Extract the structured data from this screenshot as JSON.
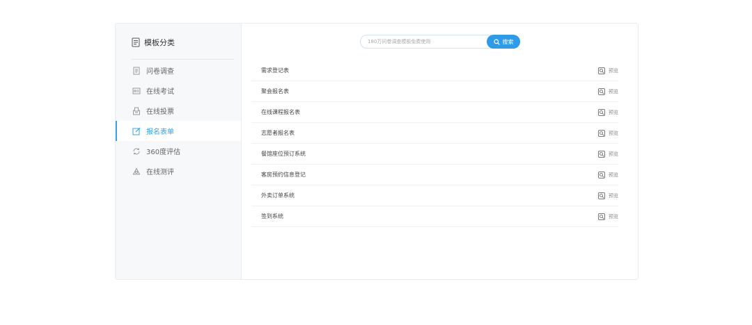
{
  "sidebar": {
    "title": "模板分类",
    "items": [
      {
        "label": "问卷调查",
        "icon": "document-list-icon",
        "active": false
      },
      {
        "label": "在线考试",
        "icon": "exam-icon",
        "active": false
      },
      {
        "label": "在线投票",
        "icon": "ballot-box-icon",
        "active": false
      },
      {
        "label": "报名表单",
        "icon": "edit-form-icon",
        "active": true
      },
      {
        "label": "360度评估",
        "icon": "cycle-icon",
        "active": false
      },
      {
        "label": "在线测评",
        "icon": "recycle-triangle-icon",
        "active": false
      }
    ]
  },
  "search": {
    "placeholder": "180万问卷调查模板免费使用",
    "button_label": "搜索"
  },
  "templates": [
    {
      "title": "需求登记表",
      "preview_label": "预览"
    },
    {
      "title": "聚会报名表",
      "preview_label": "预览"
    },
    {
      "title": "在线课程报名表",
      "preview_label": "预览"
    },
    {
      "title": "志愿者报名表",
      "preview_label": "预览"
    },
    {
      "title": "餐馆座位预订系统",
      "preview_label": "预览"
    },
    {
      "title": "客房预约信息登记",
      "preview_label": "预览"
    },
    {
      "title": "外卖订单系统",
      "preview_label": "预览"
    },
    {
      "title": "签到系统",
      "preview_label": "预览"
    }
  ],
  "colors": {
    "accent": "#2e9ae8",
    "sidebar_bg": "#f7f8fa"
  }
}
